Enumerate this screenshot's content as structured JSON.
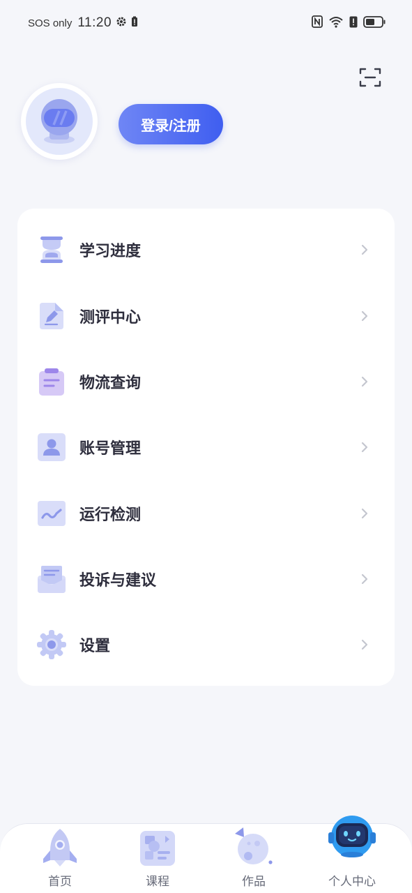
{
  "status_bar": {
    "carrier": "SOS only",
    "time": "11:20",
    "icons": [
      "gear-icon",
      "battery-alert-icon",
      "nfc-icon",
      "wifi-icon",
      "alert-icon",
      "battery-icon"
    ]
  },
  "header": {
    "scan_icon": "scan-icon",
    "avatar_icon": "astronaut-helmet-icon",
    "login_label": "登录/注册"
  },
  "menu": {
    "items": [
      {
        "label": "学习进度",
        "icon": "hourglass-icon"
      },
      {
        "label": "测评中心",
        "icon": "edit-document-icon"
      },
      {
        "label": "物流查询",
        "icon": "clipboard-icon"
      },
      {
        "label": "账号管理",
        "icon": "user-account-icon"
      },
      {
        "label": "运行检测",
        "icon": "wave-monitor-icon"
      },
      {
        "label": "投诉与建议",
        "icon": "mail-feedback-icon"
      },
      {
        "label": "设置",
        "icon": "settings-gear-icon"
      }
    ]
  },
  "bottom_nav": {
    "items": [
      {
        "label": "首页",
        "icon": "rocket-icon"
      },
      {
        "label": "课程",
        "icon": "course-board-icon"
      },
      {
        "label": "作品",
        "icon": "planet-icon"
      },
      {
        "label": "个人中心",
        "icon": "robot-icon"
      }
    ],
    "active_index": 3
  },
  "colors": {
    "accent": "#4a66f2",
    "icon_light": "#d6d9f8",
    "icon_dark": "#8f95e8",
    "background": "#f5f6fa"
  }
}
